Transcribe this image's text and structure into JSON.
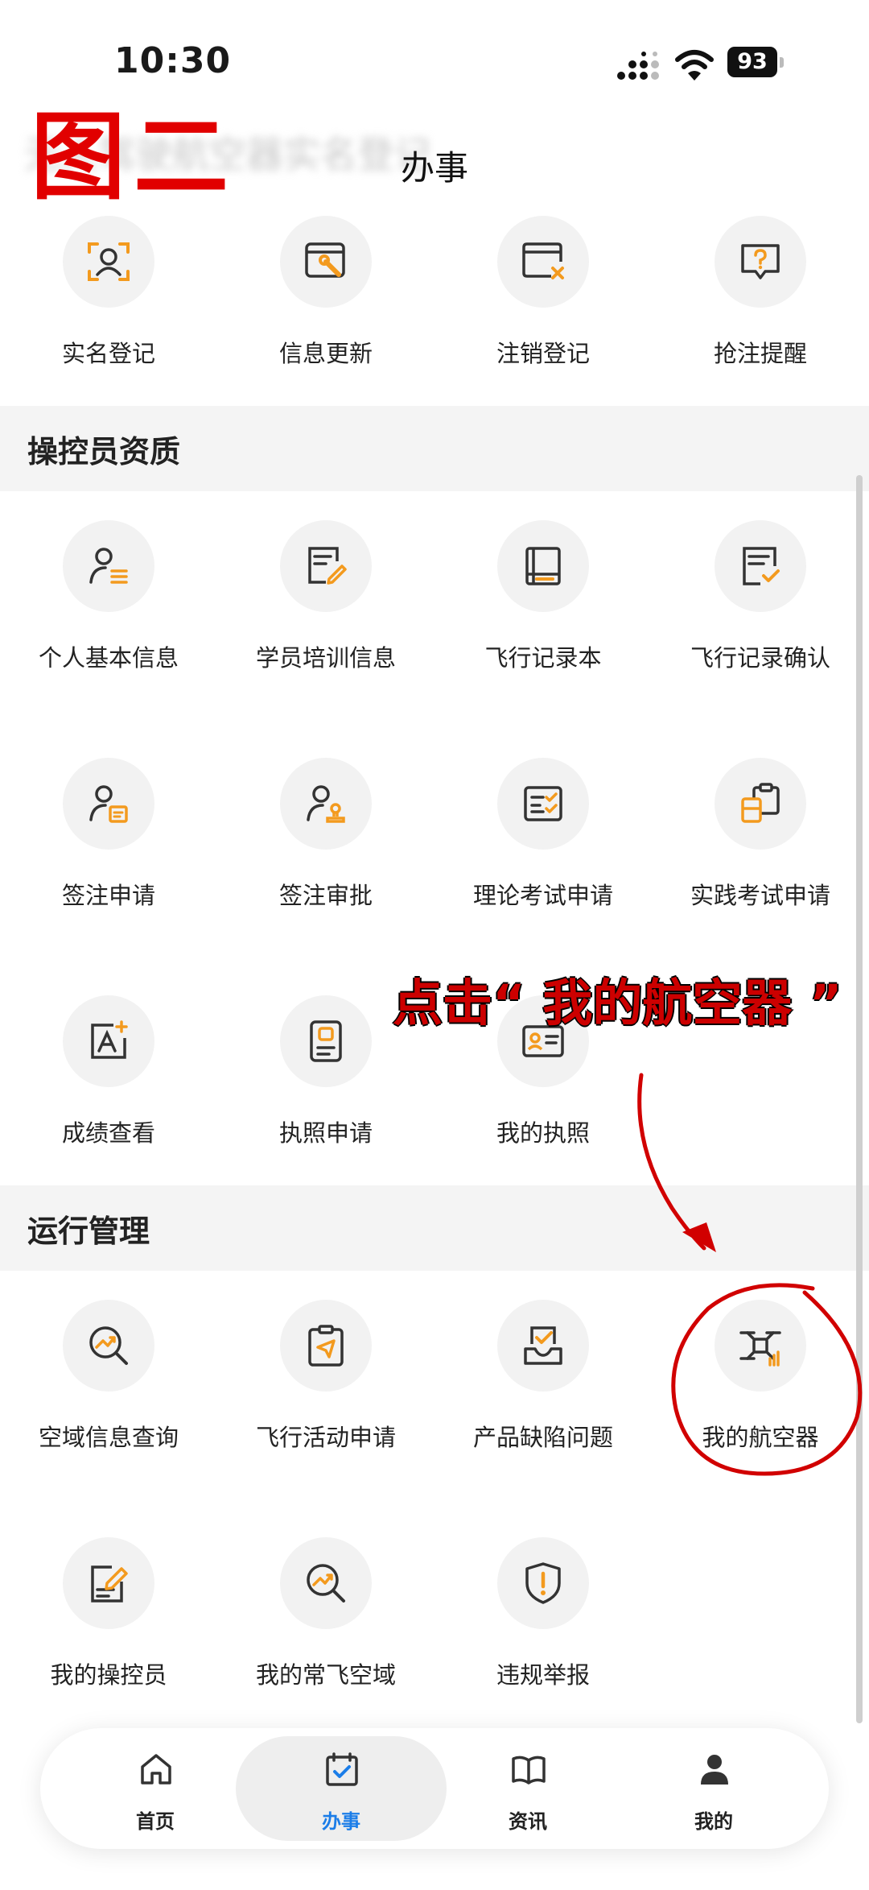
{
  "status_bar": {
    "time": "10:30",
    "battery": "93"
  },
  "header": {
    "blurred_title": "无人驾驶航空器实名登记",
    "title": "办事",
    "watermark": "图二"
  },
  "sections": [
    {
      "title": "",
      "items": [
        {
          "label": "实名登记",
          "icon": "face-scan-icon"
        },
        {
          "label": "信息更新",
          "icon": "window-wrench-icon"
        },
        {
          "label": "注销登记",
          "icon": "window-close-icon"
        },
        {
          "label": "抢注提醒",
          "icon": "question-bubble-icon"
        }
      ]
    },
    {
      "title": "操控员资质",
      "items": [
        {
          "label": "个人基本信息",
          "icon": "person-list-icon"
        },
        {
          "label": "学员培训信息",
          "icon": "doc-pen-icon"
        },
        {
          "label": "飞行记录本",
          "icon": "book-icon"
        },
        {
          "label": "飞行记录确认",
          "icon": "doc-check-icon"
        },
        {
          "label": "签注申请",
          "icon": "person-doc-icon"
        },
        {
          "label": "签注审批",
          "icon": "person-stamp-icon"
        },
        {
          "label": "理论考试申请",
          "icon": "checklist-icon"
        },
        {
          "label": "实践考试申请",
          "icon": "clipboard-copy-icon"
        },
        {
          "label": "成绩查看",
          "icon": "letter-a-icon"
        },
        {
          "label": "执照申请",
          "icon": "id-card-icon"
        },
        {
          "label": "我的执照",
          "icon": "license-card-icon"
        }
      ]
    },
    {
      "title": "运行管理",
      "items": [
        {
          "label": "空域信息查询",
          "icon": "search-trend-icon"
        },
        {
          "label": "飞行活动申请",
          "icon": "clipboard-plane-icon"
        },
        {
          "label": "产品缺陷问题",
          "icon": "tray-check-icon"
        },
        {
          "label": "我的航空器",
          "icon": "drone-icon"
        },
        {
          "label": "我的操控员",
          "icon": "doc-edit-icon"
        },
        {
          "label": "我的常飞空域",
          "icon": "search-trend-icon"
        },
        {
          "label": "违规举报",
          "icon": "shield-alert-icon"
        }
      ]
    }
  ],
  "annotation": {
    "text": "点击“ 我的航空器 ”"
  },
  "tab_bar": [
    {
      "label": "首页",
      "icon": "home-icon"
    },
    {
      "label": "办事",
      "icon": "calendar-check-icon",
      "active": true
    },
    {
      "label": "资讯",
      "icon": "open-book-icon"
    },
    {
      "label": "我的",
      "icon": "user-icon"
    }
  ],
  "colors": {
    "accent_orange": "#f39a1e",
    "tab_active_blue": "#1b7de8",
    "annotation_red": "#cc0000",
    "icon_gray": "#333333"
  }
}
